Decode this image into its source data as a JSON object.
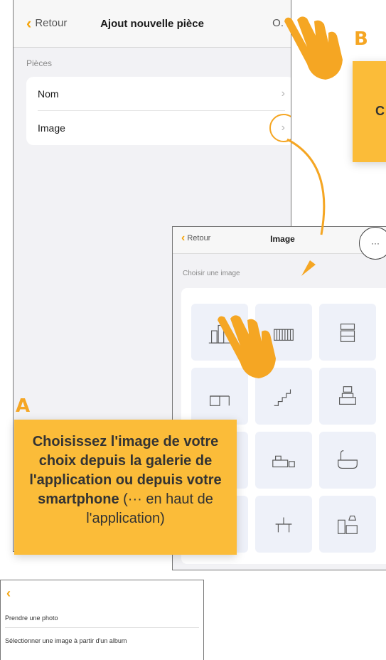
{
  "screen1": {
    "back_label": "Retour",
    "title": "Ajout nouvelle pièce",
    "ok_label": "O.",
    "section_label": "Pièces",
    "rows": [
      {
        "label": "Nom"
      },
      {
        "label": "Image"
      }
    ]
  },
  "screen2": {
    "back_label": "Retour",
    "title": "Image",
    "dots_label": "···",
    "section_label": "Choisir une image",
    "tiles": [
      "city-icon",
      "crib-icon",
      "dresser-icon",
      "desk-icon",
      "stairs-icon",
      "sofa-icon",
      "bed-icon",
      "bed-table-icon",
      "bathtub-icon",
      "shelf-icon",
      "dining-table-icon",
      "kitchen-icon",
      "washer-icon",
      "toilet-icon",
      "bookshelf-icon"
    ]
  },
  "screen3": {
    "options": [
      "Prendre une photo",
      "Sélectionner une image à partir d'un album"
    ]
  },
  "callouts": {
    "b_letter": "B",
    "b_text": "C",
    "a_letter": "A",
    "a_text_bold": "Choisissez l'image de votre choix depuis la galerie de l'application ou depuis votre smartphone",
    "a_text_normal": " (··· en haut de l'application)"
  },
  "colors": {
    "accent": "#f5a623",
    "callout": "#fbbc39",
    "tile": "#eef1f9"
  }
}
